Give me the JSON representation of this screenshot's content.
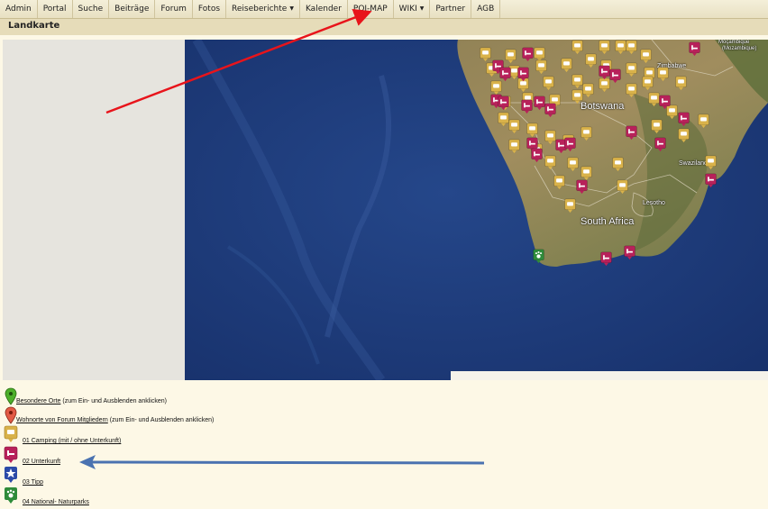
{
  "nav": {
    "items": [
      {
        "label": "Admin"
      },
      {
        "label": "Portal"
      },
      {
        "label": "Suche"
      },
      {
        "label": "Beiträge"
      },
      {
        "label": "Forum"
      },
      {
        "label": "Fotos"
      },
      {
        "label": "Reiseberichte",
        "dropdown": true
      },
      {
        "label": "Kalender"
      },
      {
        "label": "POI-MAP"
      },
      {
        "label": "WIKI",
        "dropdown": true
      },
      {
        "label": "Partner"
      },
      {
        "label": "AGB"
      }
    ]
  },
  "page": {
    "title": "Landkarte"
  },
  "map": {
    "labels": {
      "botswana": "Botswana",
      "south_africa": "South Africa",
      "zimbabwe": "Zimbabwe",
      "swaziland": "Swaziland",
      "lesotho": "Lesotho",
      "mocambique_1": "Moçambique",
      "mocambique_2": "(Mozambique)"
    },
    "colors": {
      "ocean": "#1f3d7a",
      "land": "#9b8a5c",
      "camping": "#d9b24a",
      "unterkunft": "#b8215a",
      "naturpark": "#2e8b3a"
    }
  },
  "legend": {
    "items": [
      {
        "link": "Besondere Orte",
        "suffix": "(zum Ein- und Ausblenden anklicken)",
        "icon": "green-pin-icon"
      },
      {
        "link": "Wohnorte von Forum Mitgliedern",
        "suffix": "(zum Ein- und Ausblenden anklicken)",
        "icon": "red-pin-icon"
      },
      {
        "link": "01 Camping (mit / ohne Unterkunft)",
        "suffix": "",
        "icon": "camping-marker-icon"
      },
      {
        "link": "02 Unterkunft",
        "suffix": "",
        "icon": "bed-marker-icon"
      },
      {
        "link": "03 Tipp",
        "suffix": "",
        "icon": "star-marker-icon"
      },
      {
        "link": "04 National- Naturparks",
        "suffix": "",
        "icon": "paw-marker-icon"
      }
    ]
  }
}
